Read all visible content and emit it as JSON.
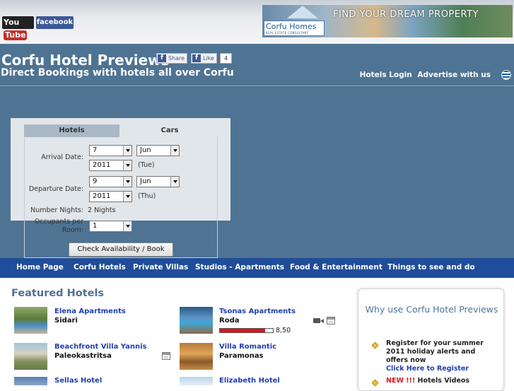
{
  "topbar": {
    "youtube": {
      "you": "You",
      "tube": "Tube"
    },
    "facebook": "facebook",
    "banner": {
      "logo_text": "Corfu Homes",
      "logo_sub": "REAL ESTATE CONSULTANT",
      "tagline": "FIND YOUR DREAM PROPERTY"
    }
  },
  "header": {
    "title": "Corfu Hotel Previews",
    "subtitle": "Direct Bookings with hotels all over Corfu",
    "share_label": "Share",
    "like_label": "Like",
    "like_count": "4",
    "links": [
      "Hotels Login",
      "Advertise with us"
    ]
  },
  "search": {
    "tabs": [
      "Hotels",
      "Cars"
    ],
    "arrival_label": "Arrival Date:",
    "arrival_day": "7",
    "arrival_month": "Jun",
    "arrival_year": "2011",
    "arrival_dayname": "(Tue)",
    "departure_label": "Departure Date:",
    "departure_day": "9",
    "departure_month": "Jun",
    "departure_year": "2011",
    "departure_dayname": "(Thu)",
    "nights_label": "Number Nights:",
    "nights_value": "2 Nights",
    "occupants_label_1": "Occupants per",
    "occupants_label_2": "Room:",
    "occupants_value": "1",
    "submit": "Check Availability / Book Now"
  },
  "nav": [
    "Home Page",
    "Corfu Hotels",
    "Private Villas",
    "Studios - Apartments",
    "Food & Entertainment",
    "Things to see and do"
  ],
  "featured": {
    "title": "Featured Hotels",
    "hotels": [
      {
        "name": "Elena Apartments",
        "location": "Sidari"
      },
      {
        "name": "Tsonas Apartments",
        "location": "Roda",
        "rating": "8,50",
        "rating_fraction": 0.85
      },
      {
        "name": "Beachfront Villa Yannis",
        "location": "Paleokastritsa"
      },
      {
        "name": "Villa Romantic",
        "location": "Paramonas"
      },
      {
        "name": "Sellas Hotel",
        "location": ""
      },
      {
        "name": "Elizabeth Hotel",
        "location": ""
      }
    ]
  },
  "why": {
    "title": "Why use Corfu Hotel Previews",
    "item1_text": "Register for your summer 2011 holiday alerts and offers now",
    "item1_link": "Click Here to Register",
    "item2_new": "NEW !!!",
    "item2_text": " Hotels Videos"
  },
  "colors": {
    "header": "#4e7393",
    "nav": "#1f4d99",
    "link": "#1f3fb0",
    "rating": "#e0131e"
  }
}
